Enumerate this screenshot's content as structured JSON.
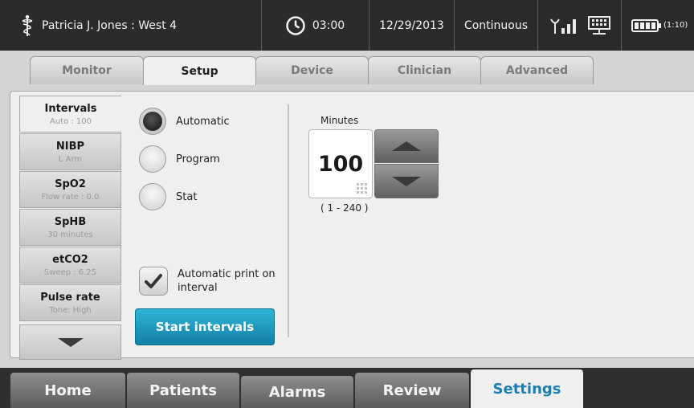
{
  "topbar": {
    "patient": "Patricia J. Jones : West 4",
    "time": "03:00",
    "date": "12/29/2013",
    "mode": "Continuous",
    "battery_time": "(1:10)",
    "icons": [
      "caduceus-icon",
      "clock-icon",
      "wifi-signal-icon",
      "network-icon",
      "battery-icon"
    ]
  },
  "tabs": [
    {
      "label": "Monitor"
    },
    {
      "label": "Setup"
    },
    {
      "label": "Device"
    },
    {
      "label": "Clinician"
    },
    {
      "label": "Advanced"
    }
  ],
  "sidemenu": [
    {
      "title": "Intervals",
      "sub": "Auto : 100"
    },
    {
      "title": "NIBP",
      "sub": "L  Arm"
    },
    {
      "title": "SpO2",
      "sub": "Flow rate : 0.0"
    },
    {
      "title": "SpHB",
      "sub": "30 minutes"
    },
    {
      "title": "etCO2",
      "sub": "Sweep : 6.25"
    },
    {
      "title": "Pulse rate",
      "sub": "Tone: High"
    }
  ],
  "intervals": {
    "options": [
      {
        "label": "Automatic",
        "selected": true
      },
      {
        "label": "Program",
        "selected": false
      },
      {
        "label": "Stat",
        "selected": false
      }
    ],
    "print_label": "Automatic print on interval",
    "print_checked": true,
    "start_label": "Start intervals",
    "minutes_label": "Minutes",
    "minutes_value": "100",
    "minutes_range": "( 1 - 240 )"
  },
  "bottomnav": [
    {
      "label": "Home"
    },
    {
      "label": "Patients"
    },
    {
      "label": "Alarms"
    },
    {
      "label": "Review"
    },
    {
      "label": "Settings"
    }
  ],
  "colors": {
    "accent": "#1c7fae",
    "button": "#2fb6d8",
    "topbar_bg": "#2b2b2b",
    "panel_bg": "#efefef"
  }
}
